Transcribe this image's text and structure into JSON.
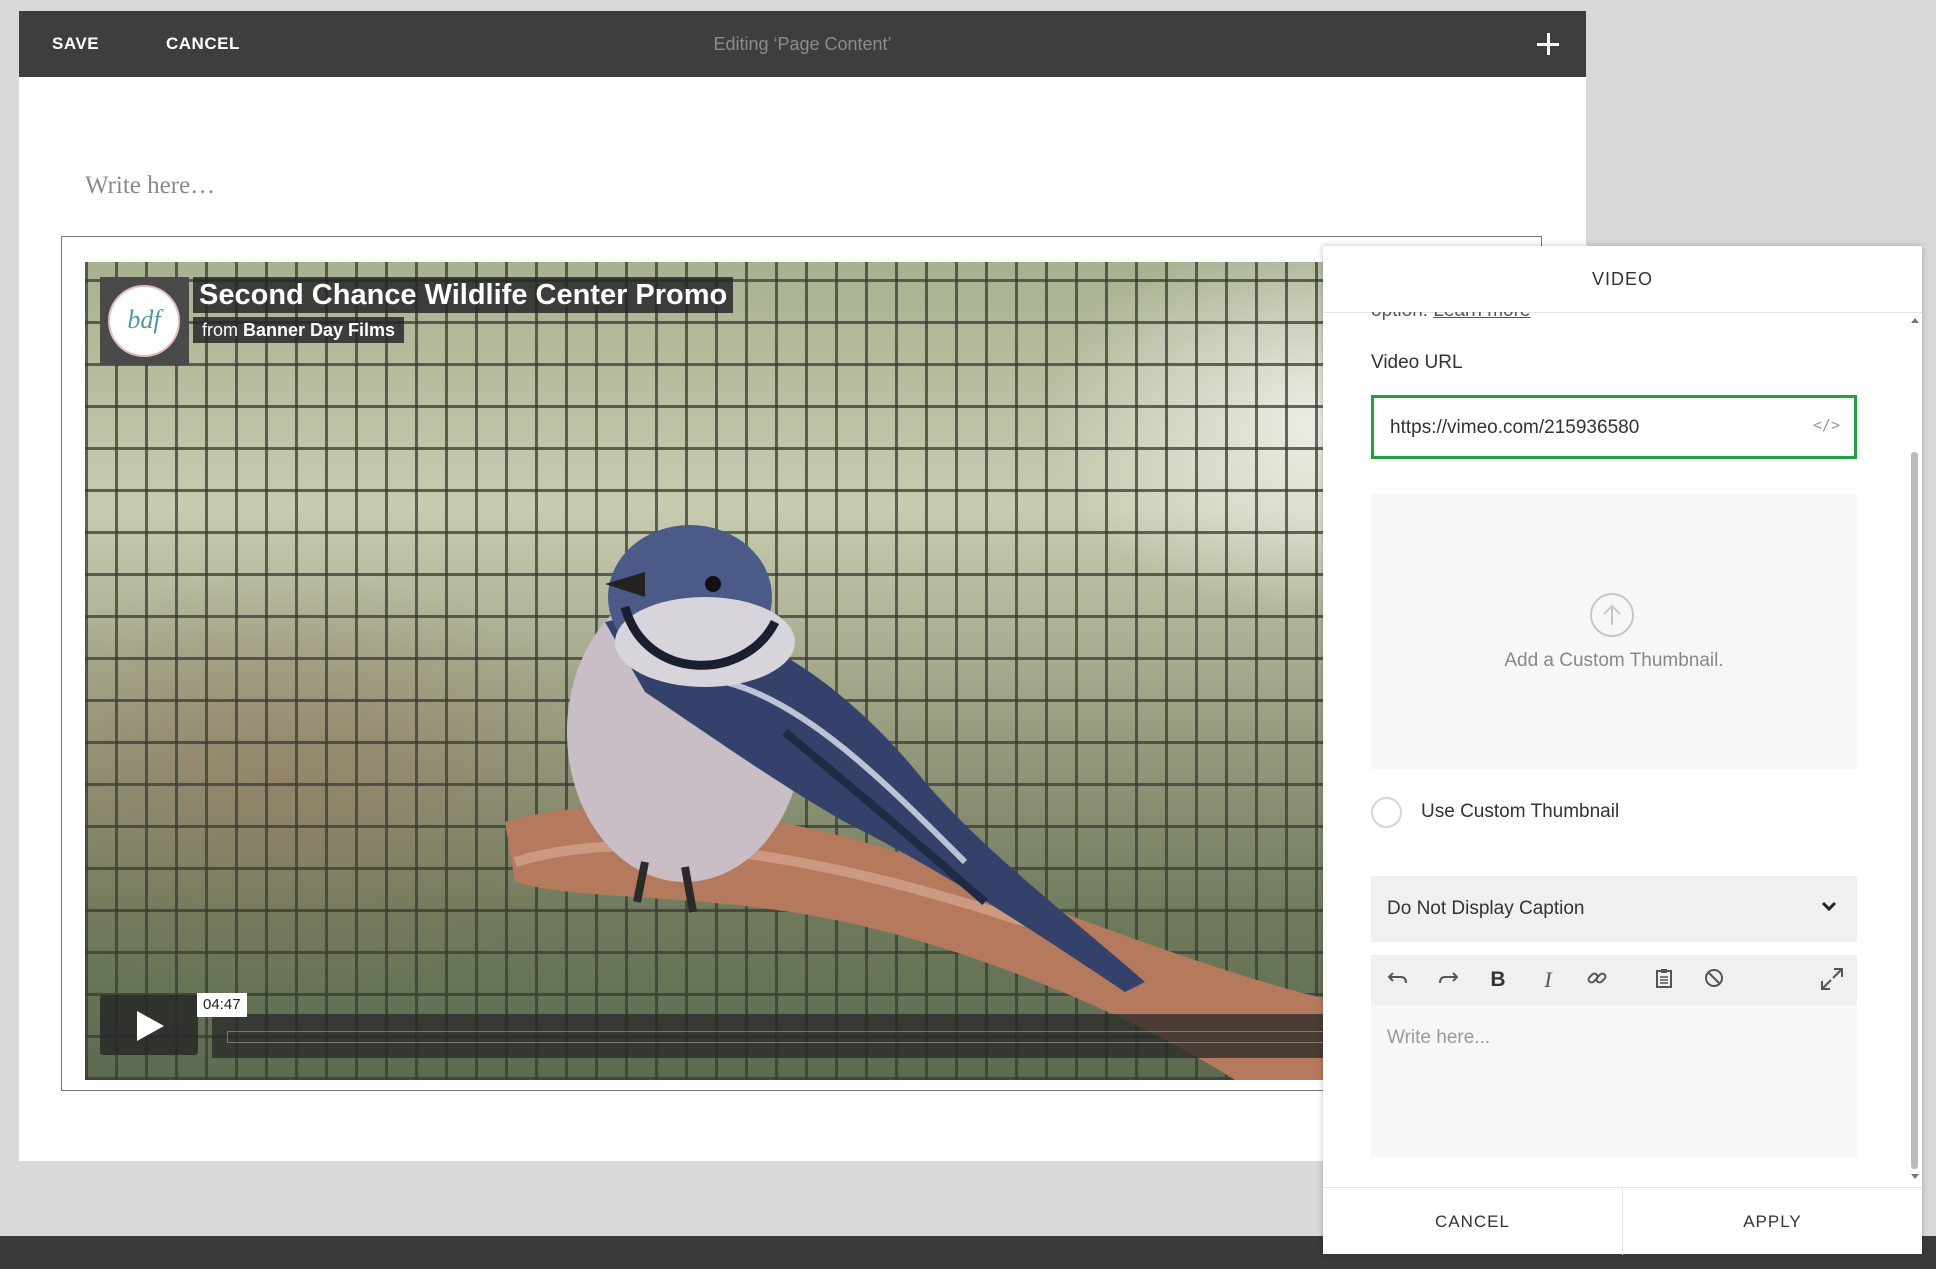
{
  "topbar": {
    "save_label": "SAVE",
    "cancel_label": "CANCEL",
    "title": "Editing ‘Page Content’",
    "add_icon": "plus-icon"
  },
  "page": {
    "write_placeholder": "Write here…"
  },
  "video": {
    "title": "Second Chance Wildlife Center Promo",
    "byline_prefix": "from",
    "byline_author": "Banner Day Films",
    "logo_text": "bdf",
    "time": "04:47",
    "play_icon": "play-icon"
  },
  "panel": {
    "header": "VIDEO",
    "learn_prefix": "option.",
    "learn_link": "Learn more",
    "url_label": "Video URL",
    "url_value": "https://vimeo.com/215936580",
    "embed_icon": "</>",
    "thumbnail_text": "Add a Custom Thumbnail.",
    "custom_thumb_label": "Use Custom Thumbnail",
    "caption_select_value": "Do Not Display Caption",
    "editor_placeholder": "Write here...",
    "toolbar_icons": [
      "undo-icon",
      "redo-icon",
      "bold-icon",
      "italic-icon",
      "link-icon",
      "paste-icon",
      "clear-format-icon",
      "expand-icon"
    ],
    "cancel_label": "CANCEL",
    "apply_label": "APPLY"
  },
  "colors": {
    "topbar": "#3e3e3e",
    "url_focus_border": "#22a33a",
    "panel_bg": "#ffffff"
  }
}
